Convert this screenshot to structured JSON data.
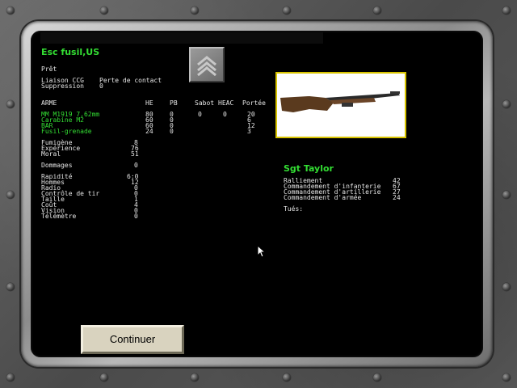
{
  "unit": {
    "name": "Esc fusil,US",
    "status": "Prêt",
    "liaison_label": "Liaison CCG",
    "liaison_value": "Perte de contact",
    "suppression_label": "Suppression",
    "suppression_value": "0"
  },
  "weapons": {
    "headers": [
      "ARME",
      "HE",
      "PB",
      "Sabot",
      "HEAC",
      "Portée"
    ],
    "rows": [
      {
        "name": "MM M1919 7,62mm",
        "he": "80",
        "pb": "0",
        "sabot": "0",
        "heac": "0",
        "range": "20"
      },
      {
        "name": "Carabine M2",
        "he": "60",
        "pb": "0",
        "sabot": "",
        "heac": "",
        "range": "6"
      },
      {
        "name": "BAR",
        "he": "60",
        "pb": "0",
        "sabot": "",
        "heac": "",
        "range": "12"
      },
      {
        "name": "Fusil-grenade",
        "he": "24",
        "pb": "0",
        "sabot": "",
        "heac": "",
        "range": "3"
      }
    ]
  },
  "stats1": [
    {
      "label": "Fumigène",
      "value": "8"
    },
    {
      "label": "Expérience",
      "value": "76"
    },
    {
      "label": "Moral",
      "value": "51"
    }
  ],
  "damage": {
    "label": "Dommages",
    "value": "0"
  },
  "stats2": [
    {
      "label": "Rapidité",
      "value": "6:0"
    },
    {
      "label": "Hommes",
      "value": "12"
    },
    {
      "label": "Radio",
      "value": "0"
    },
    {
      "label": "Contrôle de tir",
      "value": "0"
    },
    {
      "label": "Taille",
      "value": "1"
    },
    {
      "label": "Coût",
      "value": "4"
    },
    {
      "label": "Vision",
      "value": "0"
    },
    {
      "label": "Télémètre",
      "value": "0"
    }
  ],
  "leader": {
    "name": "Sgt Taylor",
    "stats": [
      {
        "label": "Ralliement",
        "value": "42"
      },
      {
        "label": "Commandement d'infanterie",
        "value": "67"
      },
      {
        "label": "Commandement d'artillerie",
        "value": "27"
      },
      {
        "label": "Commandement d'armée",
        "value": "24"
      }
    ],
    "kills_label": "Tués:"
  },
  "buttons": {
    "continue": "Continuer"
  },
  "icons": {
    "rank": "sergeant-chevrons-icon",
    "weapon": "m1-garand-rifle-icon",
    "cursor": "mouse-pointer-icon"
  },
  "colors": {
    "accent_green": "#33dd33",
    "text": "#e6e6e6",
    "weapon_border": "#d8c400"
  }
}
